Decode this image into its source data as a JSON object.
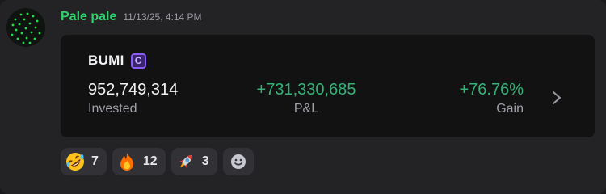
{
  "message": {
    "username": "Pale pale",
    "timestamp": "11/13/25, 4:14 PM",
    "avatar_icon": "green-dots-avatar-icon"
  },
  "card": {
    "ticker": "BUMI",
    "badge": "C",
    "invested": {
      "value": "952,749,314",
      "label": "Invested"
    },
    "pnl": {
      "value": "+731,330,685",
      "label": "P&L"
    },
    "gain": {
      "value": "+76.76%",
      "label": "Gain"
    },
    "chevron_icon": "chevron-right-icon"
  },
  "reactions": [
    {
      "icon": "rolling-on-floor-laughing-emoji",
      "count": "7"
    },
    {
      "icon": "fire-emoji",
      "count": "12"
    },
    {
      "icon": "rocket-emoji",
      "count": "3"
    }
  ],
  "add_reaction_icon": "smiley-face-icon",
  "colors": {
    "username": "#2fd36a",
    "positive": "#37b076",
    "badge": "#8b5cf6",
    "card_bg": "#121213",
    "frame_bg": "#232326"
  }
}
